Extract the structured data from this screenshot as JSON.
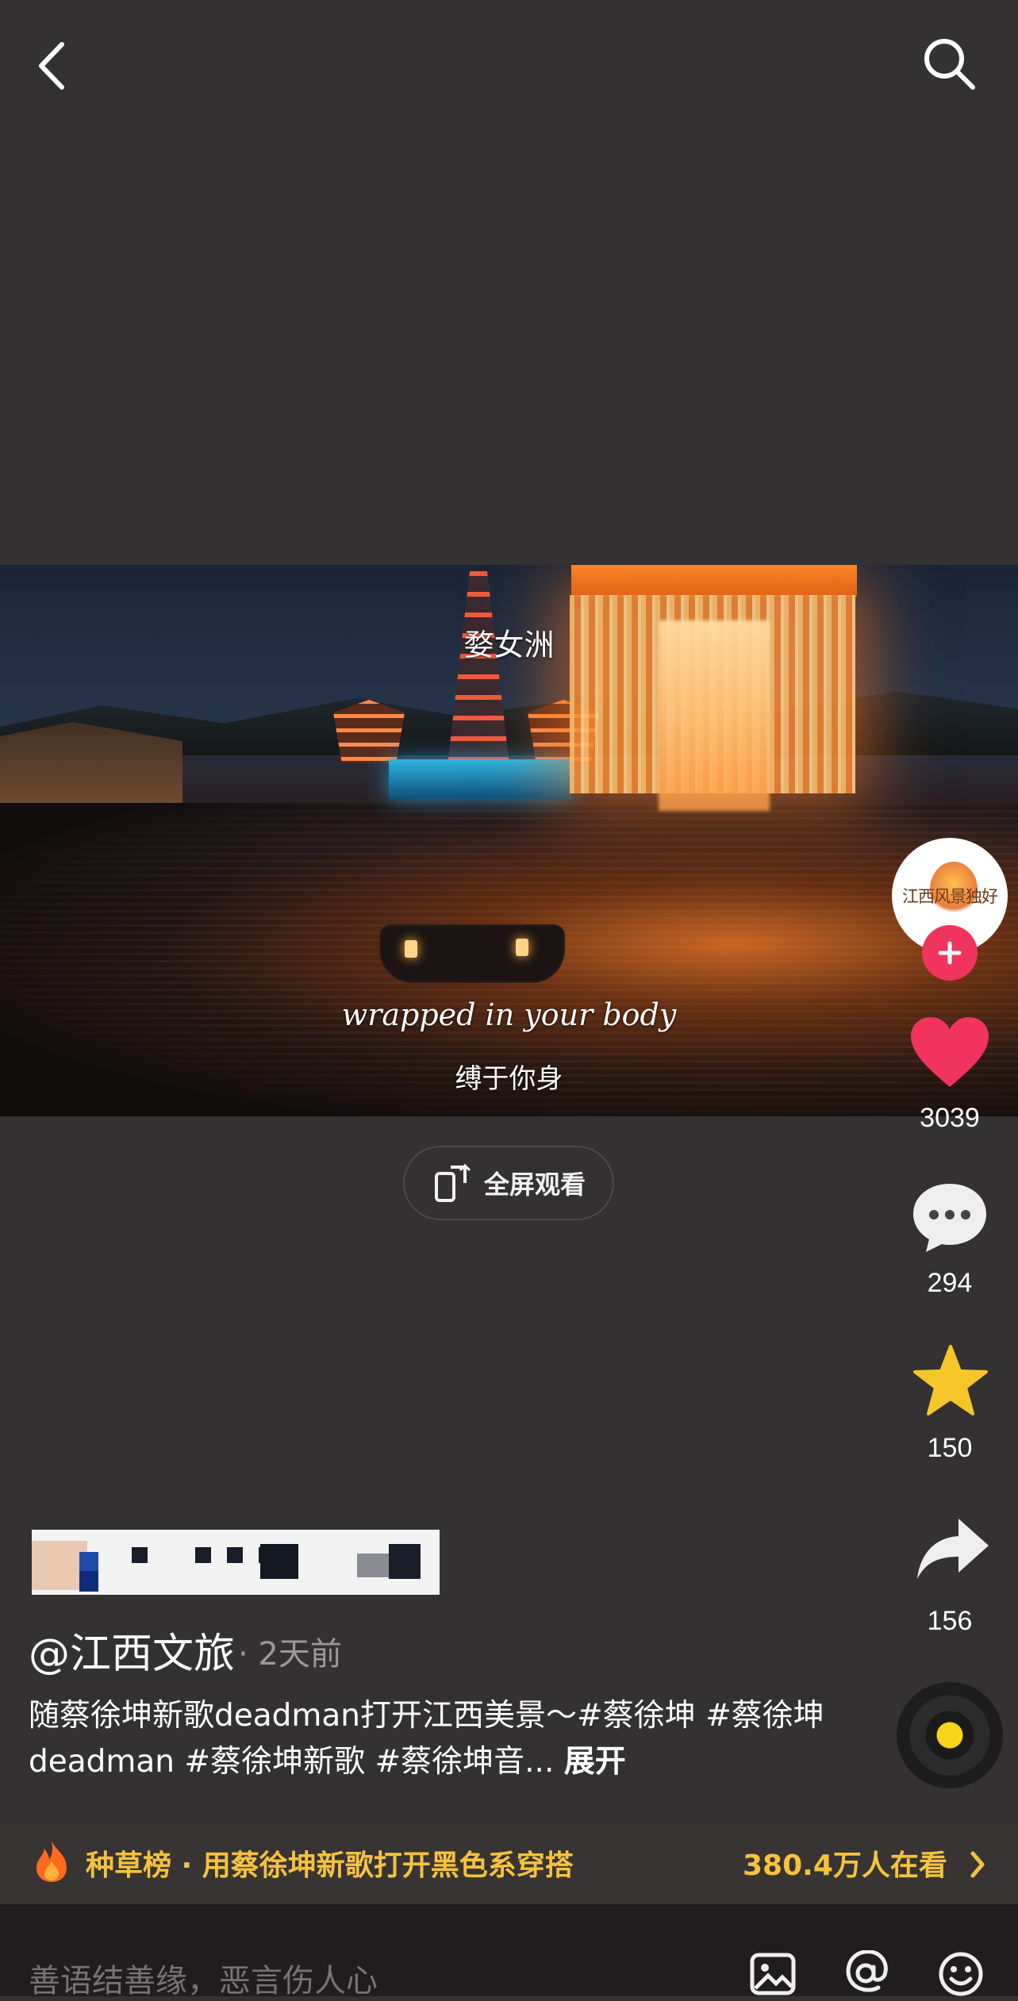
{
  "header": {
    "back_icon": "chevron-left-icon",
    "search_icon": "search-icon"
  },
  "video": {
    "location_overlay": "婺女洲",
    "subtitle_en": "wrapped in your body",
    "subtitle_zh": "缚于你身",
    "fullscreen_label": "全屏观看"
  },
  "rail": {
    "avatar_text": "江西风景独好",
    "likes": "3039",
    "comments": "294",
    "favorites": "150",
    "shares": "156",
    "like_color": "#f0345e",
    "favorite_color": "#f6c529"
  },
  "post": {
    "author": "@江西文旅",
    "time": "· 2天前",
    "description": "随蔡徐坤新歌deadman打开江西美景～#蔡徐坤 #蔡徐坤deadman #蔡徐坤新歌 #蔡徐坤音...",
    "expand_label": "展开"
  },
  "trending": {
    "title": "种草榜 · 用蔡徐坤新歌打开黑色系穿搭",
    "viewers": "380.4万人在看",
    "accent": "#f6c23e"
  },
  "comment_bar": {
    "placeholder": "善语结善缘，恶言伤人心",
    "icons": [
      "image-icon",
      "at-icon",
      "emoji-icon"
    ]
  }
}
